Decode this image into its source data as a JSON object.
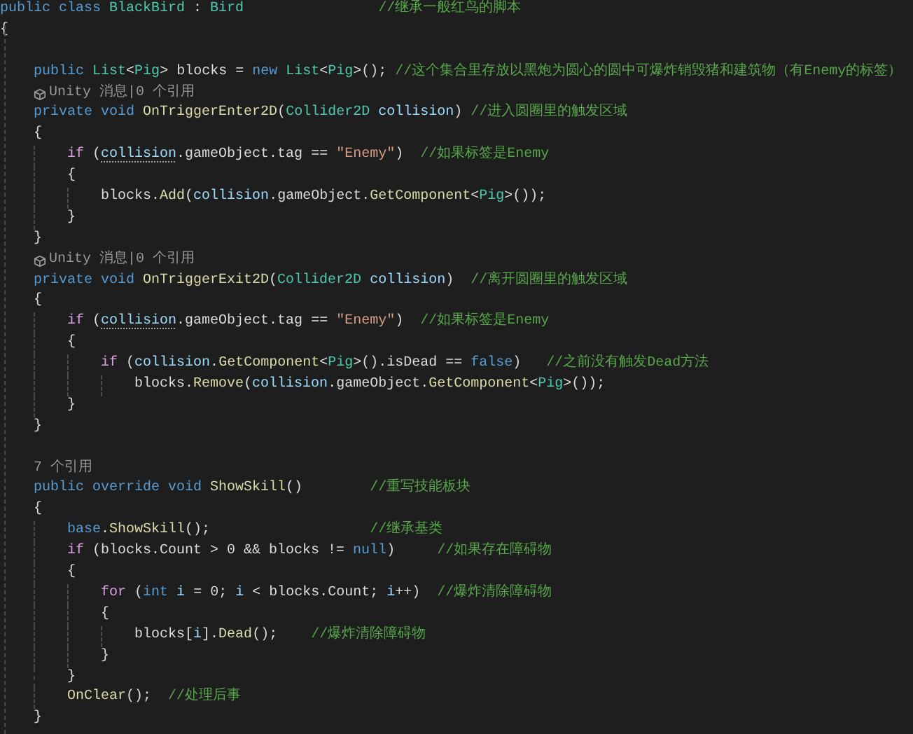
{
  "editor": {
    "lines": [
      {
        "kind": "code",
        "tokens": [
          {
            "kind": "keyword",
            "text": "public class"
          },
          {
            "kind": "class",
            "text": " BlackBird"
          },
          {
            "kind": "plain",
            "text": " : "
          },
          {
            "kind": "class",
            "text": "Bird                "
          }
        ],
        "comment": "//继承一般红鸟的脚本"
      },
      {
        "kind": "code",
        "tokens": [
          {
            "kind": "plain",
            "text": "{"
          }
        ]
      },
      {
        "kind": "blank"
      },
      {
        "kind": "code",
        "tokens": [
          {
            "kind": "keyword",
            "text": "    public"
          },
          {
            "kind": "class",
            "text": " List"
          },
          {
            "kind": "plain",
            "text": "<"
          },
          {
            "kind": "class",
            "text": "Pig"
          },
          {
            "kind": "plain",
            "text": "> blocks = "
          },
          {
            "kind": "keyword",
            "text": "new"
          },
          {
            "kind": "class",
            "text": " List"
          },
          {
            "kind": "plain",
            "text": "<"
          },
          {
            "kind": "class",
            "text": "Pig"
          },
          {
            "kind": "plain",
            "text": ">(); "
          }
        ],
        "comment": "//这个集合里存放以黑炮为圆心的圆中可爆炸销毁猪和建筑物（有Enemy的标签）"
      },
      {
        "kind": "lens",
        "icon": true,
        "text": "    Unity 消息|0 个引用"
      },
      {
        "kind": "code",
        "tokens": [
          {
            "kind": "keyword",
            "text": "    private void"
          },
          {
            "kind": "method",
            "text": " OnTriggerEnter2D"
          },
          {
            "kind": "plain",
            "text": "("
          },
          {
            "kind": "class",
            "text": "Collider2D"
          },
          {
            "kind": "param",
            "text": " collision"
          },
          {
            "kind": "plain",
            "text": ") "
          }
        ],
        "comment": "//进入圆圈里的触发区域"
      },
      {
        "kind": "code",
        "tokens": [
          {
            "kind": "plain",
            "text": "    {"
          }
        ]
      },
      {
        "kind": "code",
        "tokens": [
          {
            "kind": "control",
            "text": "        if"
          },
          {
            "kind": "plain",
            "text": " ("
          },
          {
            "kind": "param",
            "text": "collision",
            "hint": true
          },
          {
            "kind": "plain",
            "text": ".gameObject.tag == "
          },
          {
            "kind": "string",
            "text": "\"Enemy\""
          },
          {
            "kind": "plain",
            "text": ")  "
          }
        ],
        "comment": "//如果标签是Enemy"
      },
      {
        "kind": "code",
        "tokens": [
          {
            "kind": "plain",
            "text": "        {"
          }
        ]
      },
      {
        "kind": "code",
        "tokens": [
          {
            "kind": "plain",
            "text": "            blocks."
          },
          {
            "kind": "method",
            "text": "Add"
          },
          {
            "kind": "plain",
            "text": "("
          },
          {
            "kind": "param",
            "text": "collision"
          },
          {
            "kind": "plain",
            "text": ".gameObject."
          },
          {
            "kind": "method",
            "text": "GetComponent"
          },
          {
            "kind": "plain",
            "text": "<"
          },
          {
            "kind": "class",
            "text": "Pig"
          },
          {
            "kind": "plain",
            "text": ">());"
          }
        ]
      },
      {
        "kind": "code",
        "tokens": [
          {
            "kind": "plain",
            "text": "        }"
          }
        ]
      },
      {
        "kind": "code",
        "tokens": [
          {
            "kind": "plain",
            "text": "    }"
          }
        ]
      },
      {
        "kind": "lens",
        "icon": true,
        "text": "    Unity 消息|0 个引用"
      },
      {
        "kind": "code",
        "tokens": [
          {
            "kind": "keyword",
            "text": "    private void"
          },
          {
            "kind": "method",
            "text": " OnTriggerExit2D"
          },
          {
            "kind": "plain",
            "text": "("
          },
          {
            "kind": "class",
            "text": "Collider2D"
          },
          {
            "kind": "param",
            "text": " collision"
          },
          {
            "kind": "plain",
            "text": ")  "
          }
        ],
        "comment": "//离开圆圈里的触发区域"
      },
      {
        "kind": "code",
        "tokens": [
          {
            "kind": "plain",
            "text": "    {"
          }
        ]
      },
      {
        "kind": "code",
        "tokens": [
          {
            "kind": "control",
            "text": "        if"
          },
          {
            "kind": "plain",
            "text": " ("
          },
          {
            "kind": "param",
            "text": "collision",
            "hint": true
          },
          {
            "kind": "plain",
            "text": ".gameObject.tag == "
          },
          {
            "kind": "string",
            "text": "\"Enemy\""
          },
          {
            "kind": "plain",
            "text": ")  "
          }
        ],
        "comment": "//如果标签是Enemy"
      },
      {
        "kind": "code",
        "tokens": [
          {
            "kind": "plain",
            "text": "        {"
          }
        ]
      },
      {
        "kind": "code",
        "tokens": [
          {
            "kind": "control",
            "text": "            if"
          },
          {
            "kind": "plain",
            "text": " ("
          },
          {
            "kind": "param",
            "text": "collision"
          },
          {
            "kind": "plain",
            "text": "."
          },
          {
            "kind": "method",
            "text": "GetComponent"
          },
          {
            "kind": "plain",
            "text": "<"
          },
          {
            "kind": "class",
            "text": "Pig"
          },
          {
            "kind": "plain",
            "text": ">().isDead == "
          },
          {
            "kind": "keyword",
            "text": "false"
          },
          {
            "kind": "plain",
            "text": ")   "
          }
        ],
        "comment": "//之前没有触发Dead方法"
      },
      {
        "kind": "code",
        "tokens": [
          {
            "kind": "plain",
            "text": "                blocks."
          },
          {
            "kind": "method",
            "text": "Remove"
          },
          {
            "kind": "plain",
            "text": "("
          },
          {
            "kind": "param",
            "text": "collision"
          },
          {
            "kind": "plain",
            "text": ".gameObject."
          },
          {
            "kind": "method",
            "text": "GetComponent"
          },
          {
            "kind": "plain",
            "text": "<"
          },
          {
            "kind": "class",
            "text": "Pig"
          },
          {
            "kind": "plain",
            "text": ">());"
          }
        ]
      },
      {
        "kind": "code",
        "tokens": [
          {
            "kind": "plain",
            "text": "        }"
          }
        ]
      },
      {
        "kind": "code",
        "tokens": [
          {
            "kind": "plain",
            "text": "    }"
          }
        ]
      },
      {
        "kind": "blank"
      },
      {
        "kind": "lens",
        "icon": false,
        "text": "    7 个引用"
      },
      {
        "kind": "code",
        "tokens": [
          {
            "kind": "keyword",
            "text": "    public override void"
          },
          {
            "kind": "method",
            "text": " ShowSkill"
          },
          {
            "kind": "plain",
            "text": "()        "
          }
        ],
        "comment": "//重写技能板块"
      },
      {
        "kind": "code",
        "tokens": [
          {
            "kind": "plain",
            "text": "    {"
          }
        ]
      },
      {
        "kind": "code",
        "tokens": [
          {
            "kind": "keyword",
            "text": "        base"
          },
          {
            "kind": "plain",
            "text": "."
          },
          {
            "kind": "method",
            "text": "ShowSkill"
          },
          {
            "kind": "plain",
            "text": "();                   "
          }
        ],
        "comment": "//继承基类"
      },
      {
        "kind": "code",
        "tokens": [
          {
            "kind": "control",
            "text": "        if"
          },
          {
            "kind": "plain",
            "text": " (blocks.Count > 0 && blocks != "
          },
          {
            "kind": "keyword",
            "text": "null"
          },
          {
            "kind": "plain",
            "text": ")     "
          }
        ],
        "comment": "//如果存在障碍物"
      },
      {
        "kind": "code",
        "tokens": [
          {
            "kind": "plain",
            "text": "        {"
          }
        ]
      },
      {
        "kind": "code",
        "tokens": [
          {
            "kind": "control",
            "text": "            for"
          },
          {
            "kind": "plain",
            "text": " ("
          },
          {
            "kind": "keyword",
            "text": "int"
          },
          {
            "kind": "param",
            "text": " i"
          },
          {
            "kind": "plain",
            "text": " = 0; "
          },
          {
            "kind": "param",
            "text": "i"
          },
          {
            "kind": "plain",
            "text": " < blocks.Count; "
          },
          {
            "kind": "param",
            "text": "i"
          },
          {
            "kind": "plain",
            "text": "++)  "
          }
        ],
        "comment": "//爆炸清除障碍物"
      },
      {
        "kind": "code",
        "tokens": [
          {
            "kind": "plain",
            "text": "            {"
          }
        ]
      },
      {
        "kind": "code",
        "tokens": [
          {
            "kind": "plain",
            "text": "                blocks["
          },
          {
            "kind": "param",
            "text": "i"
          },
          {
            "kind": "plain",
            "text": "]."
          },
          {
            "kind": "method",
            "text": "Dead"
          },
          {
            "kind": "plain",
            "text": "();    "
          }
        ],
        "comment": "//爆炸清除障碍物"
      },
      {
        "kind": "code",
        "tokens": [
          {
            "kind": "plain",
            "text": "            }"
          }
        ]
      },
      {
        "kind": "code",
        "tokens": [
          {
            "kind": "plain",
            "text": "        }"
          }
        ]
      },
      {
        "kind": "code",
        "tokens": [
          {
            "kind": "method",
            "text": "        OnClear"
          },
          {
            "kind": "plain",
            "text": "();  "
          }
        ],
        "comment": "//处理后事"
      },
      {
        "kind": "code",
        "tokens": [
          {
            "kind": "plain",
            "text": "    }"
          }
        ]
      }
    ]
  }
}
